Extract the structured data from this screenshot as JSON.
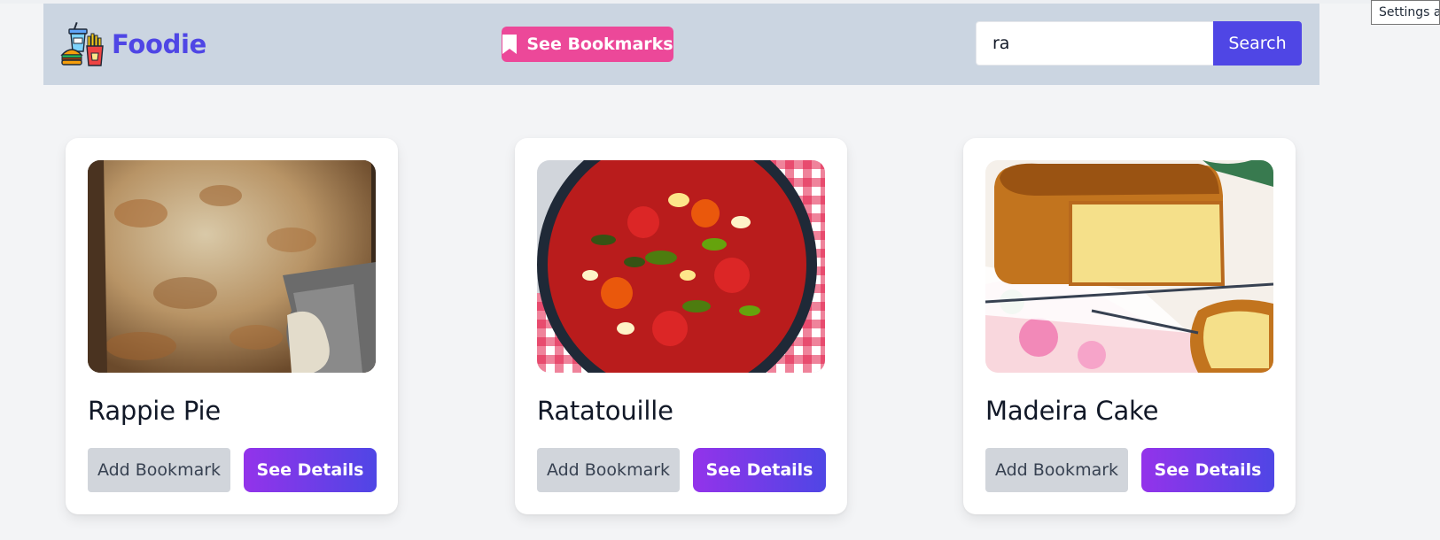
{
  "navbar": {
    "brand": "Foodie",
    "bookmarks_button": "See Bookmarks",
    "search": {
      "value": "ra",
      "button": "Search"
    }
  },
  "tooltip": "Settings ar",
  "recipes": [
    {
      "title": "Rappie Pie",
      "add_bookmark": "Add Bookmark",
      "see_details": "See Details"
    },
    {
      "title": "Ratatouille",
      "add_bookmark": "Add Bookmark",
      "see_details": "See Details"
    },
    {
      "title": "Madeira Cake",
      "add_bookmark": "Add Bookmark",
      "see_details": "See Details"
    }
  ],
  "colors": {
    "navbar_bg": "#cbd5e1",
    "brand": "#4f46e5",
    "bookmarks_button": "#ec4899",
    "search_button": "#4f46e5",
    "add_bookmark_button": "#d1d5db",
    "details_gradient": [
      "#9333ea",
      "#4f46e5"
    ]
  },
  "icons": {
    "brand_logo": "fast-food-icon",
    "bookmarks": "bookmark-icon"
  }
}
